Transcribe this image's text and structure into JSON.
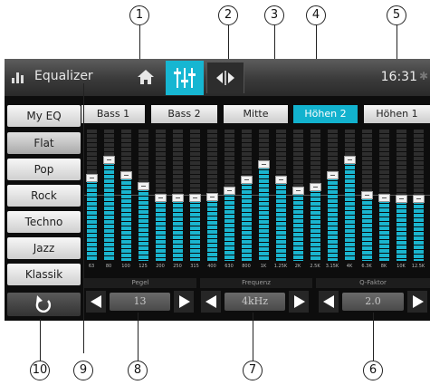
{
  "callouts": [
    "1",
    "2",
    "3",
    "4",
    "5",
    "6",
    "7",
    "8",
    "9",
    "10"
  ],
  "header": {
    "title": "Equalizer",
    "clock": "16:31",
    "icons": [
      "equalizer-icon",
      "home-icon",
      "sliders-icon",
      "balance-icon",
      "bluetooth-icon"
    ]
  },
  "presets": [
    "My EQ",
    "Flat",
    "Pop",
    "Rock",
    "Techno",
    "Jazz",
    "Klassik"
  ],
  "selected_preset": "Flat",
  "bands": [
    "Bass 1",
    "Bass 2",
    "Mitte",
    "Höhen 2",
    "Höhen 1"
  ],
  "active_band": "Höhen 2",
  "frequencies": [
    "63",
    "80",
    "100",
    "125",
    "200",
    "250",
    "315",
    "400",
    "630",
    "800",
    "1K",
    "1.25K",
    "2K",
    "2.5K",
    "3.15K",
    "4K",
    "6.3K",
    "8K",
    "10K",
    "12.5K"
  ],
  "levels": [
    0.33,
    0.6,
    0.36,
    0.2,
    0.03,
    0.02,
    0.02,
    0.04,
    0.14,
    0.3,
    0.53,
    0.3,
    0.14,
    0.19,
    0.36,
    0.6,
    0.06,
    0.02,
    0.01,
    0.01
  ],
  "controls": {
    "pegel": {
      "label": "Pegel",
      "value": "13"
    },
    "frequenz": {
      "label": "Frequenz",
      "value": "4kHz"
    },
    "qfaktor": {
      "label": "Q-Faktor",
      "value": "2.0"
    }
  },
  "colors": {
    "accent": "#16b6d2",
    "bar": "#1ab5cf"
  }
}
